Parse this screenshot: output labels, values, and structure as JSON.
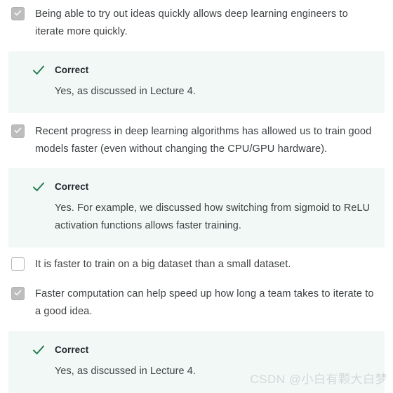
{
  "quiz": {
    "options": [
      {
        "id": "option-1",
        "state": "checked",
        "text": "Being able to try out ideas quickly allows deep learning engineers to iterate more quickly.",
        "feedback": {
          "title": "Correct",
          "body": "Yes, as discussed in Lecture 4."
        }
      },
      {
        "id": "option-2",
        "state": "checked",
        "text": "Recent progress in deep learning algorithms has allowed us to train good models faster (even without changing the CPU/GPU hardware).",
        "feedback": {
          "title": "Correct",
          "body": "Yes. For example, we discussed how switching from sigmoid to ReLU activation functions allows faster training."
        }
      },
      {
        "id": "option-3",
        "state": "unchecked",
        "text": "It is faster to train on a big dataset than a small dataset.",
        "feedback": null
      },
      {
        "id": "option-4",
        "state": "checked",
        "text": "Faster computation can help speed up how long a team takes to iterate to a good idea.",
        "feedback": {
          "title": "Correct",
          "body": "Yes, as discussed in Lecture 4."
        }
      }
    ]
  },
  "watermark": {
    "text": "CSDN @小白有颗大白梦"
  },
  "colors": {
    "feedback_background": "#f2f8f6",
    "correct_green": "#1e7a4a",
    "checkbox_checked": "#bdbdbd",
    "text": "#3c4043",
    "watermark": "#d3d8da"
  },
  "icons": {
    "checkbox_check": "checkmark-icon",
    "feedback_check": "check-icon"
  }
}
